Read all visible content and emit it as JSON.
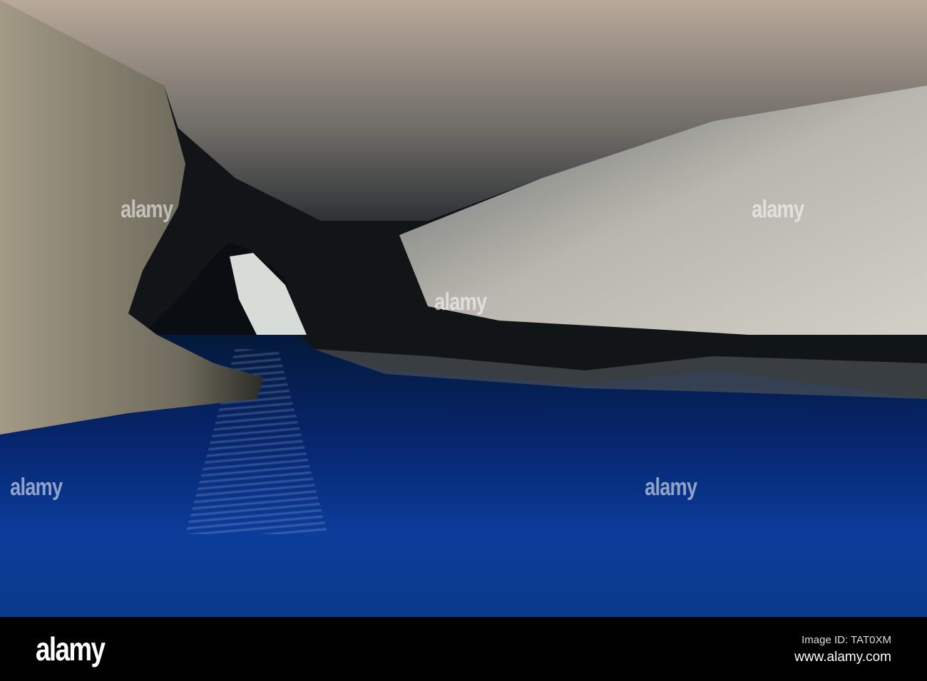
{
  "photo": {
    "subject": "sea cave"
  },
  "watermark": {
    "text": "alamy"
  },
  "footer": {
    "logo": "alamy",
    "image_id": "Image ID: TAT0XM",
    "website": "www.alamy.com"
  },
  "colors": {
    "water": "#0b3c9a",
    "shallow": "#2fb3e6",
    "rock": "#b9b3a6"
  }
}
